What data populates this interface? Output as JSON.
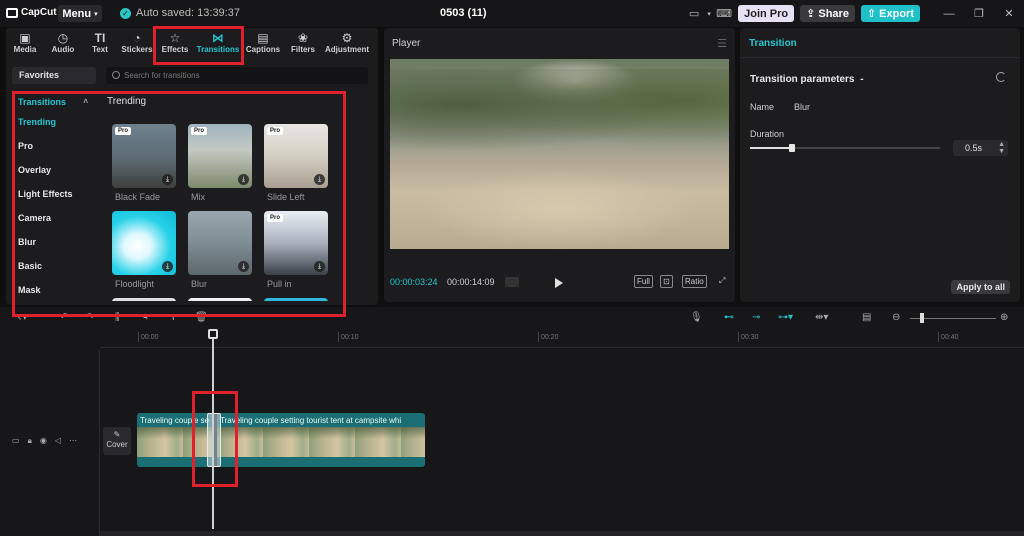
{
  "app": {
    "logo": "CapCut",
    "menu_label": "Menu",
    "autosave": "Auto saved: 13:39:37",
    "project_title": "0503 (11)",
    "join_pro": "Join Pro",
    "share": "Share",
    "export": "Export"
  },
  "toolbar": [
    {
      "label": "Media",
      "icon": "▣"
    },
    {
      "label": "Audio",
      "icon": "◷"
    },
    {
      "label": "Text",
      "icon": "TI"
    },
    {
      "label": "Stickers",
      "icon": "◔"
    },
    {
      "label": "Effects",
      "icon": "☆"
    },
    {
      "label": "Transitions",
      "icon": "⋈"
    },
    {
      "label": "Captions",
      "icon": "▤"
    },
    {
      "label": "Filters",
      "icon": "❀"
    },
    {
      "label": "Adjustment",
      "icon": "⚙"
    }
  ],
  "sidebar": {
    "favorites": "Favorites",
    "header": "Transitions",
    "categories": [
      "Trending",
      "Pro",
      "Overlay",
      "Light Effects",
      "Camera",
      "Blur",
      "Basic",
      "Mask"
    ]
  },
  "search": {
    "placeholder": "Search for transitions"
  },
  "section_title": "Trending",
  "transitions": [
    {
      "label": "Black Fade",
      "pro": "Pro"
    },
    {
      "label": "Mix",
      "pro": "Pro"
    },
    {
      "label": "Slide Left",
      "pro": "Pro"
    },
    {
      "label": "Floodlight",
      "pro": ""
    },
    {
      "label": "Blur",
      "pro": ""
    },
    {
      "label": "Pull in",
      "pro": "Pro"
    },
    {
      "label": "",
      "pro": "Pro"
    },
    {
      "label": "",
      "pro": "Pro"
    },
    {
      "label": "",
      "pro": ""
    }
  ],
  "player": {
    "title": "Player",
    "current_time": "00:00:03:24",
    "total_time": "00:00:14:09",
    "full": "Full",
    "ratio": "Ratio"
  },
  "panel": {
    "title": "Transition",
    "params_title": "Transition parameters",
    "name_label": "Name",
    "name_value": "Blur",
    "duration_label": "Duration",
    "duration_value": "0.5s",
    "duration_fraction": 0.22,
    "apply_all": "Apply to all"
  },
  "timeline": {
    "ticks": [
      "00:00",
      "00:10",
      "00:20",
      "00:30",
      "00:40"
    ],
    "cover": "Cover",
    "clip1_label": "Traveling couple se",
    "clip2_label": "Traveling couple setting tourist tent at campsite whi"
  },
  "colors": {
    "accent": "#22c6d2",
    "highlight": "#e0212c"
  }
}
